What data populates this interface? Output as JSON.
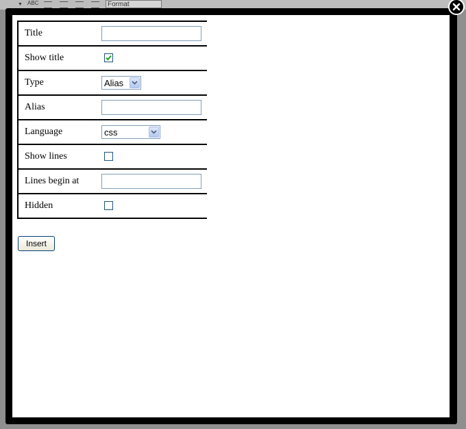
{
  "toolbar_backdrop": {
    "format_label": "Format",
    "abc_label": "ABC"
  },
  "form": {
    "title": {
      "label": "Title",
      "value": ""
    },
    "show_title": {
      "label": "Show title",
      "checked": true
    },
    "type": {
      "label": "Type",
      "selected": "Alias"
    },
    "alias": {
      "label": "Alias",
      "value": ""
    },
    "language": {
      "label": "Language",
      "selected": "css"
    },
    "show_lines": {
      "label": "Show lines",
      "checked": false
    },
    "lines_begin_at": {
      "label": "Lines begin at",
      "value": ""
    },
    "hidden": {
      "label": "Hidden",
      "checked": false
    }
  },
  "insert_button_label": "Insert",
  "icons": {
    "close": "close-icon",
    "check": "checkmark-icon",
    "dropdown": "chevron-down-icon"
  },
  "colors": {
    "modal_frame": "#000000",
    "input_border": "#7f9db9",
    "check_color": "#21a121",
    "dropdown_arrow": "#4d6185"
  }
}
